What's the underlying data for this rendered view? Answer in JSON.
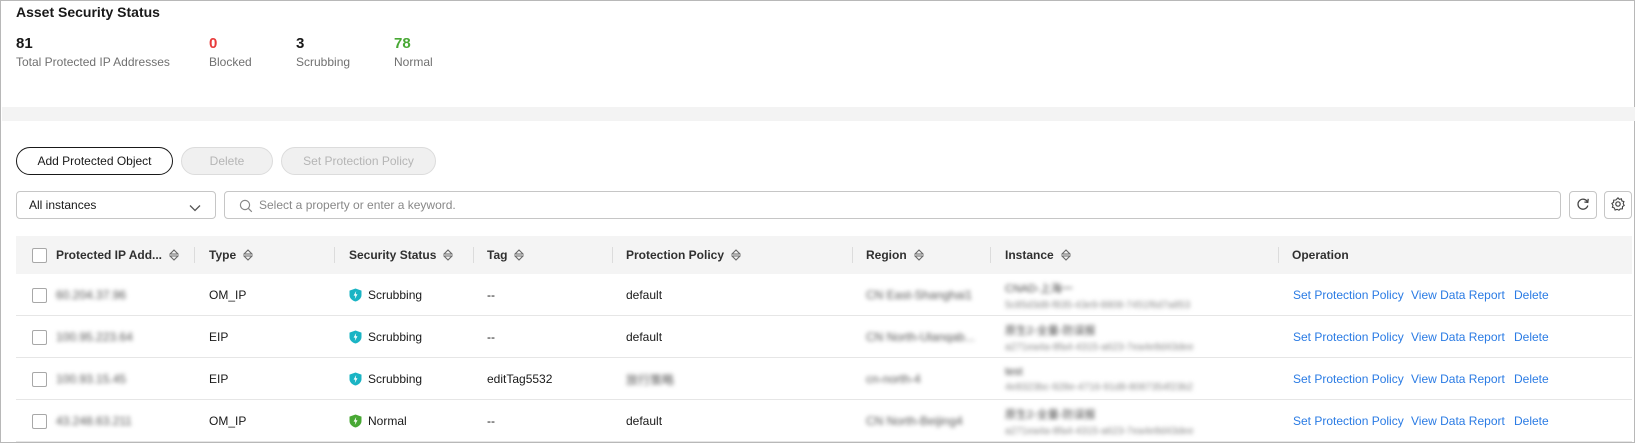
{
  "title": "Asset Security Status",
  "stats": [
    {
      "value": "81",
      "label": "Total Protected IP Addresses"
    },
    {
      "value": "0",
      "label": "Blocked"
    },
    {
      "value": "3",
      "label": "Scrubbing"
    },
    {
      "value": "78",
      "label": "Normal"
    }
  ],
  "colors": {
    "blocked": "#e83b3b",
    "normal": "#48a834",
    "scrubbing_icon": "#1ab4c4",
    "link": "#2a7be4"
  },
  "toolbar": {
    "add_label": "Add Protected Object",
    "delete_label": "Delete",
    "set_policy_label": "Set Protection Policy"
  },
  "filter": {
    "selected": "All instances",
    "search_placeholder": "Select a property or enter a keyword."
  },
  "icons": {
    "refresh": "refresh-icon",
    "settings": "gear-icon",
    "search": "search-icon",
    "sort": "sort-icon",
    "shield": "shield-icon"
  },
  "columns": [
    "Protected IP Add...",
    "Type",
    "Security Status",
    "Tag",
    "Protection Policy",
    "Region",
    "Instance",
    "Operation"
  ],
  "rows": [
    {
      "ip": "60.204.37.96",
      "type": "OM_IP",
      "status": "Scrubbing",
      "tag": "--",
      "policy": "default",
      "region": "CN East-Shanghai1",
      "instance_name": "CNAD-上海一",
      "instance_id": "5c85d3d8-f835-43e9-8808-7451f6d7a853",
      "ops": [
        "Set Protection Policy",
        "View Data Report",
        "Delete"
      ]
    },
    {
      "ip": "100.95.223.64",
      "type": "EIP",
      "status": "Scrubbing",
      "tag": "--",
      "policy": "default",
      "region": "CN North-Ulanqab...",
      "instance_name": "原生2-全量-防误报",
      "instance_id": "a271ea4a-8fa4-4315-a623-7ea4e8d43dee",
      "ops": [
        "Set Protection Policy",
        "View Data Report",
        "Delete"
      ]
    },
    {
      "ip": "100.93.15.45",
      "type": "EIP",
      "status": "Scrubbing",
      "tag": "editTag5532",
      "policy": "放行策略",
      "region": "cn-north-4",
      "instance_name": "test",
      "instance_id": "4e8323bc-928e-4716-91d8-8087354f23b2",
      "ops": [
        "Set Protection Policy",
        "View Data Report",
        "Delete"
      ]
    },
    {
      "ip": "43.248.63.211",
      "type": "OM_IP",
      "status": "Normal",
      "tag": "--",
      "policy": "default",
      "region": "CN North-Beijing4",
      "instance_name": "原生2-全量-防误报",
      "instance_id": "a271ea4a-8fa4-4315-a623-7ea4e8d43dee",
      "ops": [
        "Set Protection Policy",
        "View Data Report",
        "Delete"
      ]
    }
  ]
}
